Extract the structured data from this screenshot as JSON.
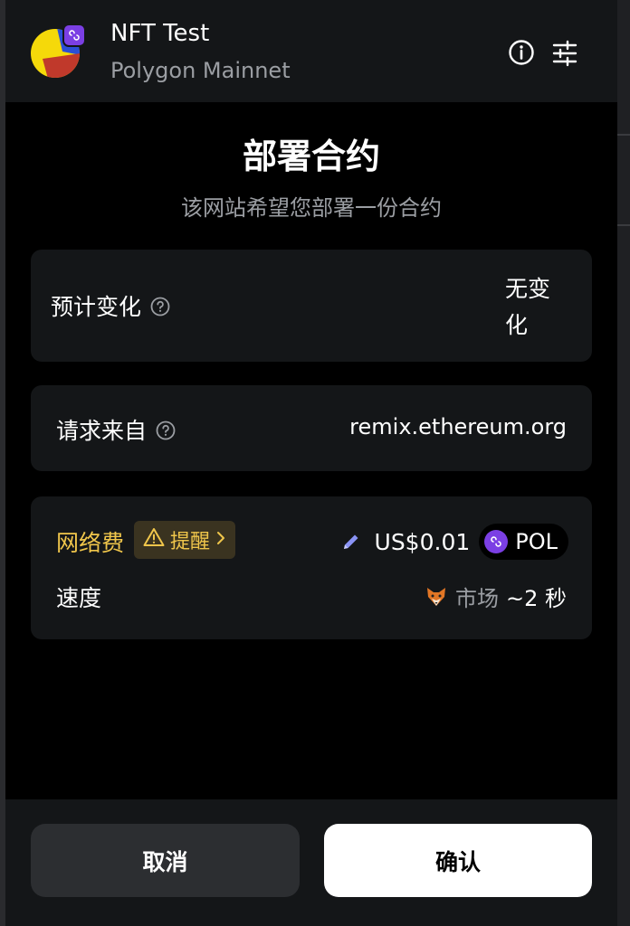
{
  "header": {
    "site_title": "NFT Test",
    "network": "Polygon Mainnet"
  },
  "main": {
    "title": "部署合约",
    "subtitle": "该网站希望您部署一份合约"
  },
  "estimated_changes": {
    "label": "预计变化",
    "value": "无变化"
  },
  "request_from": {
    "label": "请求来自",
    "value": "remix.ethereum.org"
  },
  "network_fee": {
    "label": "网络费",
    "alert_label": "提醒",
    "value": "US$0.01",
    "token": "POL"
  },
  "speed": {
    "label": "速度",
    "market": "市场",
    "time": "~2 秒"
  },
  "footer": {
    "cancel_label": "取消",
    "confirm_label": "确认"
  },
  "colors": {
    "accent_warning": "#f0c64b",
    "polygon_purple": "#7b3fe4",
    "background": "#000000",
    "card": "#141618"
  }
}
